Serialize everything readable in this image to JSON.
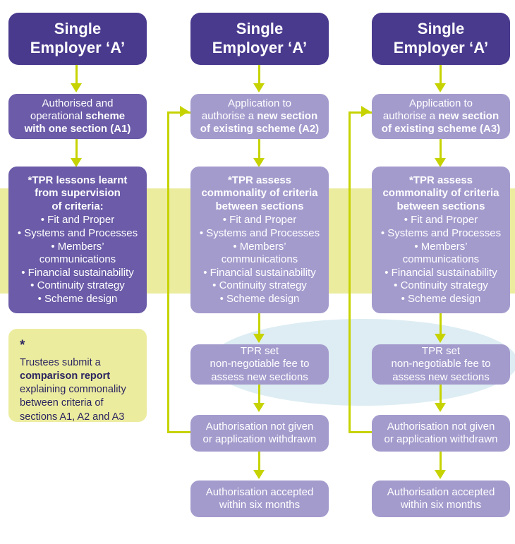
{
  "palette": {
    "header_purple": "#4a3a8e",
    "dark_purple": "#6b5ba8",
    "light_purple": "#a49bcd",
    "arrow_green": "#c6d300",
    "band_yellow": "#ecec9f",
    "band_blue": "#ddedf3",
    "note_text": "#2b2560"
  },
  "columns": [
    {
      "id": "column-a1",
      "header": {
        "line1": "Single",
        "line2": "Employer ‘A’"
      },
      "status_box": {
        "line1": "Authorised and",
        "line2_plain": "operational ",
        "line2_bold": "scheme",
        "line3_bold": "with one section (A1)"
      },
      "criteria_box": {
        "heading_lines": [
          "*TPR lessons learnt",
          "from supervision",
          "of criteria:"
        ],
        "bullets": [
          "• Fit and Proper",
          "• Systems and Processes",
          "• Members’",
          "communications",
          "• Financial sustainability",
          "• Continuity strategy",
          "• Scheme design"
        ]
      }
    },
    {
      "id": "column-a2",
      "header": {
        "line1": "Single",
        "line2": "Employer ‘A’"
      },
      "application_box": {
        "line1": "Application to",
        "line2_plain": "authorise a ",
        "line2_bold": "new section",
        "line3_bold": "of existing scheme (A2)"
      },
      "criteria_box": {
        "heading_lines": [
          "*TPR assess",
          "commonality of criteria",
          "between sections"
        ],
        "bullets": [
          "• Fit and Proper",
          "• Systems and Processes",
          "• Members’",
          "communications",
          "• Financial sustainability",
          "• Continuity strategy",
          "• Scheme design"
        ]
      },
      "fee_box": {
        "line1": "TPR set",
        "line2": "non-negotiable fee to",
        "line3": "assess new sections"
      },
      "not_given_box": {
        "line1": "Authorisation not given",
        "line2": "or application withdrawn"
      },
      "accepted_box": {
        "line1": "Authorisation accepted",
        "line2": "within six months"
      }
    },
    {
      "id": "column-a3",
      "header": {
        "line1": "Single",
        "line2": "Employer ‘A’"
      },
      "application_box": {
        "line1": "Application to",
        "line2_plain": "authorise a ",
        "line2_bold": "new section",
        "line3_bold": "of existing scheme (A3)"
      },
      "criteria_box": {
        "heading_lines": [
          "*TPR assess",
          "commonality of criteria",
          "between sections"
        ],
        "bullets": [
          "• Fit and Proper",
          "• Systems and Processes",
          "• Members’",
          "communications",
          "• Financial sustainability",
          "• Continuity strategy",
          "• Scheme design"
        ]
      },
      "fee_box": {
        "line1": "TPR set",
        "line2": "non-negotiable fee to",
        "line3": "assess new sections"
      },
      "not_given_box": {
        "line1": "Authorisation not given",
        "line2": "or application withdrawn"
      },
      "accepted_box": {
        "line1": "Authorisation accepted",
        "line2": "within six months"
      }
    }
  ],
  "footnote": {
    "marker": "*",
    "line1": "Trustees submit a",
    "bold_phrase": "comparison report",
    "line3": "explaining commonality",
    "line4": "between criteria of",
    "line5": "sections A1, A2 and A3"
  }
}
